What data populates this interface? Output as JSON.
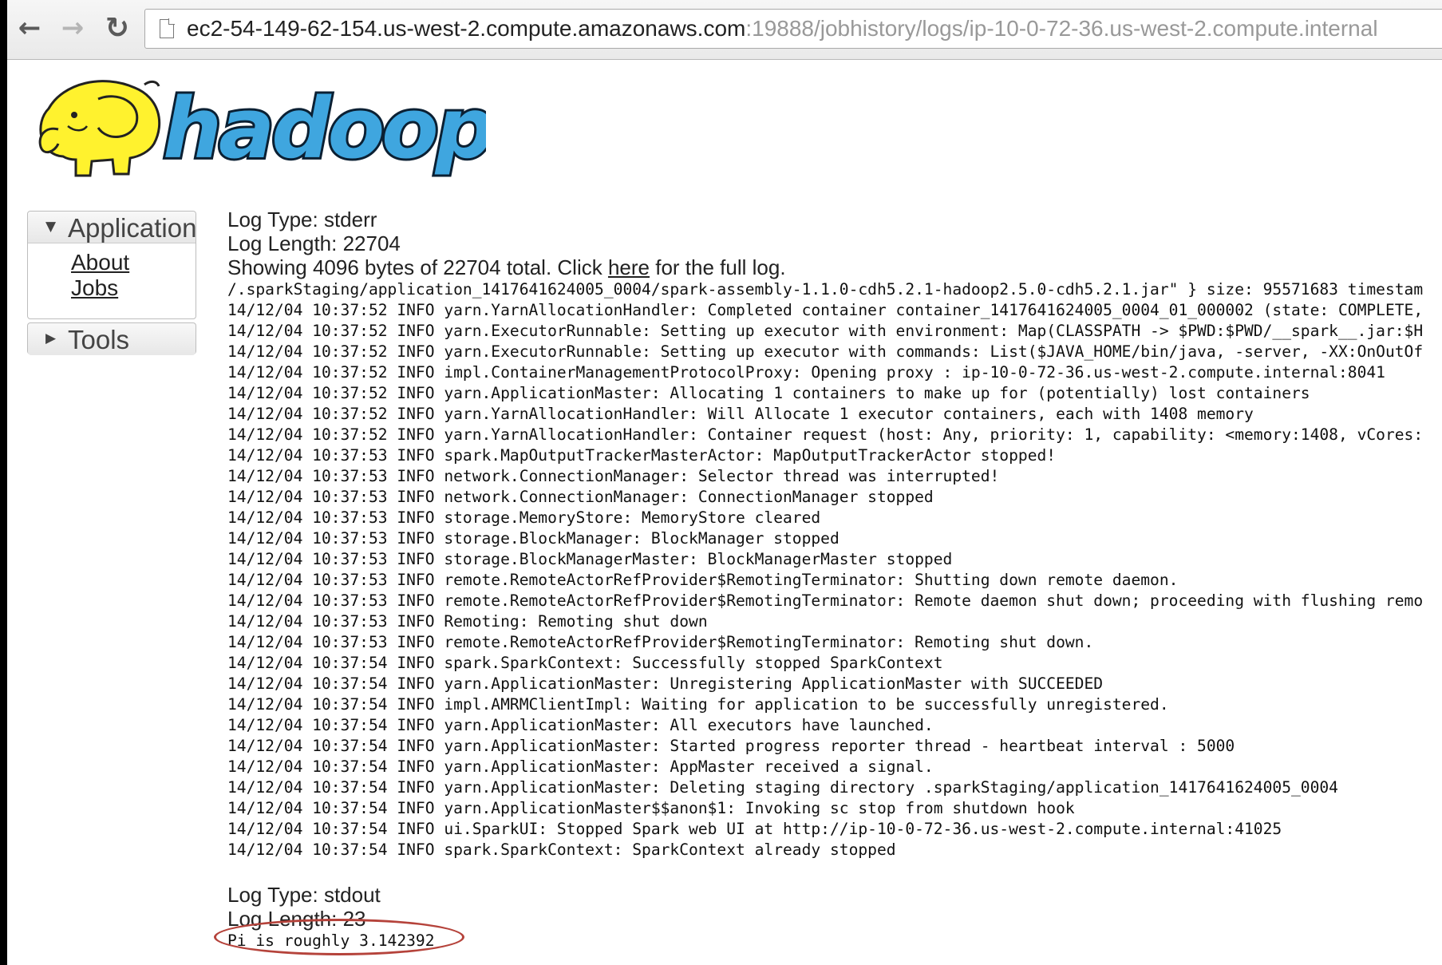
{
  "browser": {
    "url_host": "ec2-54-149-62-154.us-west-2.compute.amazonaws.com",
    "url_path": ":19888/jobhistory/logs/ip-10-0-72-36.us-west-2.compute.internal",
    "back_icon": "←",
    "forward_icon": "→",
    "reload_icon": "↻"
  },
  "logo": {
    "text": "hadoop",
    "colors": {
      "text": "#3fa6df",
      "elephant": "#fff22e"
    }
  },
  "sidebar": {
    "application": {
      "label": "Application",
      "arrow": "▼",
      "links": [
        "About",
        "Jobs"
      ]
    },
    "tools": {
      "label": "Tools",
      "arrow": "▶"
    }
  },
  "stderr": {
    "type_line": "Log Type: stderr",
    "length_line": "Log Length: 22704",
    "showing_pre": "Showing 4096 bytes of 22704 total. Click ",
    "here_link": "here",
    "showing_post": " for the full log.",
    "lines": [
      "/.sparkStaging/application_1417641624005_0004/spark-assembly-1.1.0-cdh5.2.1-hadoop2.5.0-cdh5.2.1.jar\" } size: 95571683 timestam",
      "14/12/04 10:37:52 INFO yarn.YarnAllocationHandler: Completed container container_1417641624005_0004_01_000002 (state: COMPLETE,",
      "14/12/04 10:37:52 INFO yarn.ExecutorRunnable: Setting up executor with environment: Map(CLASSPATH -> $PWD:$PWD/__spark__.jar:$H",
      "14/12/04 10:37:52 INFO yarn.ExecutorRunnable: Setting up executor with commands: List($JAVA_HOME/bin/java, -server, -XX:OnOutOf",
      "14/12/04 10:37:52 INFO impl.ContainerManagementProtocolProxy: Opening proxy : ip-10-0-72-36.us-west-2.compute.internal:8041",
      "14/12/04 10:37:52 INFO yarn.ApplicationMaster: Allocating 1 containers to make up for (potentially) lost containers",
      "14/12/04 10:37:52 INFO yarn.YarnAllocationHandler: Will Allocate 1 executor containers, each with 1408 memory",
      "14/12/04 10:37:52 INFO yarn.YarnAllocationHandler: Container request (host: Any, priority: 1, capability: <memory:1408, vCores:",
      "14/12/04 10:37:53 INFO spark.MapOutputTrackerMasterActor: MapOutputTrackerActor stopped!",
      "14/12/04 10:37:53 INFO network.ConnectionManager: Selector thread was interrupted!",
      "14/12/04 10:37:53 INFO network.ConnectionManager: ConnectionManager stopped",
      "14/12/04 10:37:53 INFO storage.MemoryStore: MemoryStore cleared",
      "14/12/04 10:37:53 INFO storage.BlockManager: BlockManager stopped",
      "14/12/04 10:37:53 INFO storage.BlockManagerMaster: BlockManagerMaster stopped",
      "14/12/04 10:37:53 INFO remote.RemoteActorRefProvider$RemotingTerminator: Shutting down remote daemon.",
      "14/12/04 10:37:53 INFO remote.RemoteActorRefProvider$RemotingTerminator: Remote daemon shut down; proceeding with flushing remo",
      "14/12/04 10:37:53 INFO Remoting: Remoting shut down",
      "14/12/04 10:37:53 INFO remote.RemoteActorRefProvider$RemotingTerminator: Remoting shut down.",
      "14/12/04 10:37:54 INFO spark.SparkContext: Successfully stopped SparkContext",
      "14/12/04 10:37:54 INFO yarn.ApplicationMaster: Unregistering ApplicationMaster with SUCCEEDED",
      "14/12/04 10:37:54 INFO impl.AMRMClientImpl: Waiting for application to be successfully unregistered.",
      "14/12/04 10:37:54 INFO yarn.ApplicationMaster: All executors have launched.",
      "14/12/04 10:37:54 INFO yarn.ApplicationMaster: Started progress reporter thread - heartbeat interval : 5000",
      "14/12/04 10:37:54 INFO yarn.ApplicationMaster: AppMaster received a signal.",
      "14/12/04 10:37:54 INFO yarn.ApplicationMaster: Deleting staging directory .sparkStaging/application_1417641624005_0004",
      "14/12/04 10:37:54 INFO yarn.ApplicationMaster$$anon$1: Invoking sc stop from shutdown hook",
      "14/12/04 10:37:54 INFO ui.SparkUI: Stopped Spark web UI at http://ip-10-0-72-36.us-west-2.compute.internal:41025",
      "14/12/04 10:37:54 INFO spark.SparkContext: SparkContext already stopped"
    ]
  },
  "stdout": {
    "type_line": "Log Type: stdout",
    "length_line": "Log Length: 23",
    "content": "Pi is roughly 3.142392"
  },
  "annotation": {
    "oval_color": "#b5433b"
  }
}
